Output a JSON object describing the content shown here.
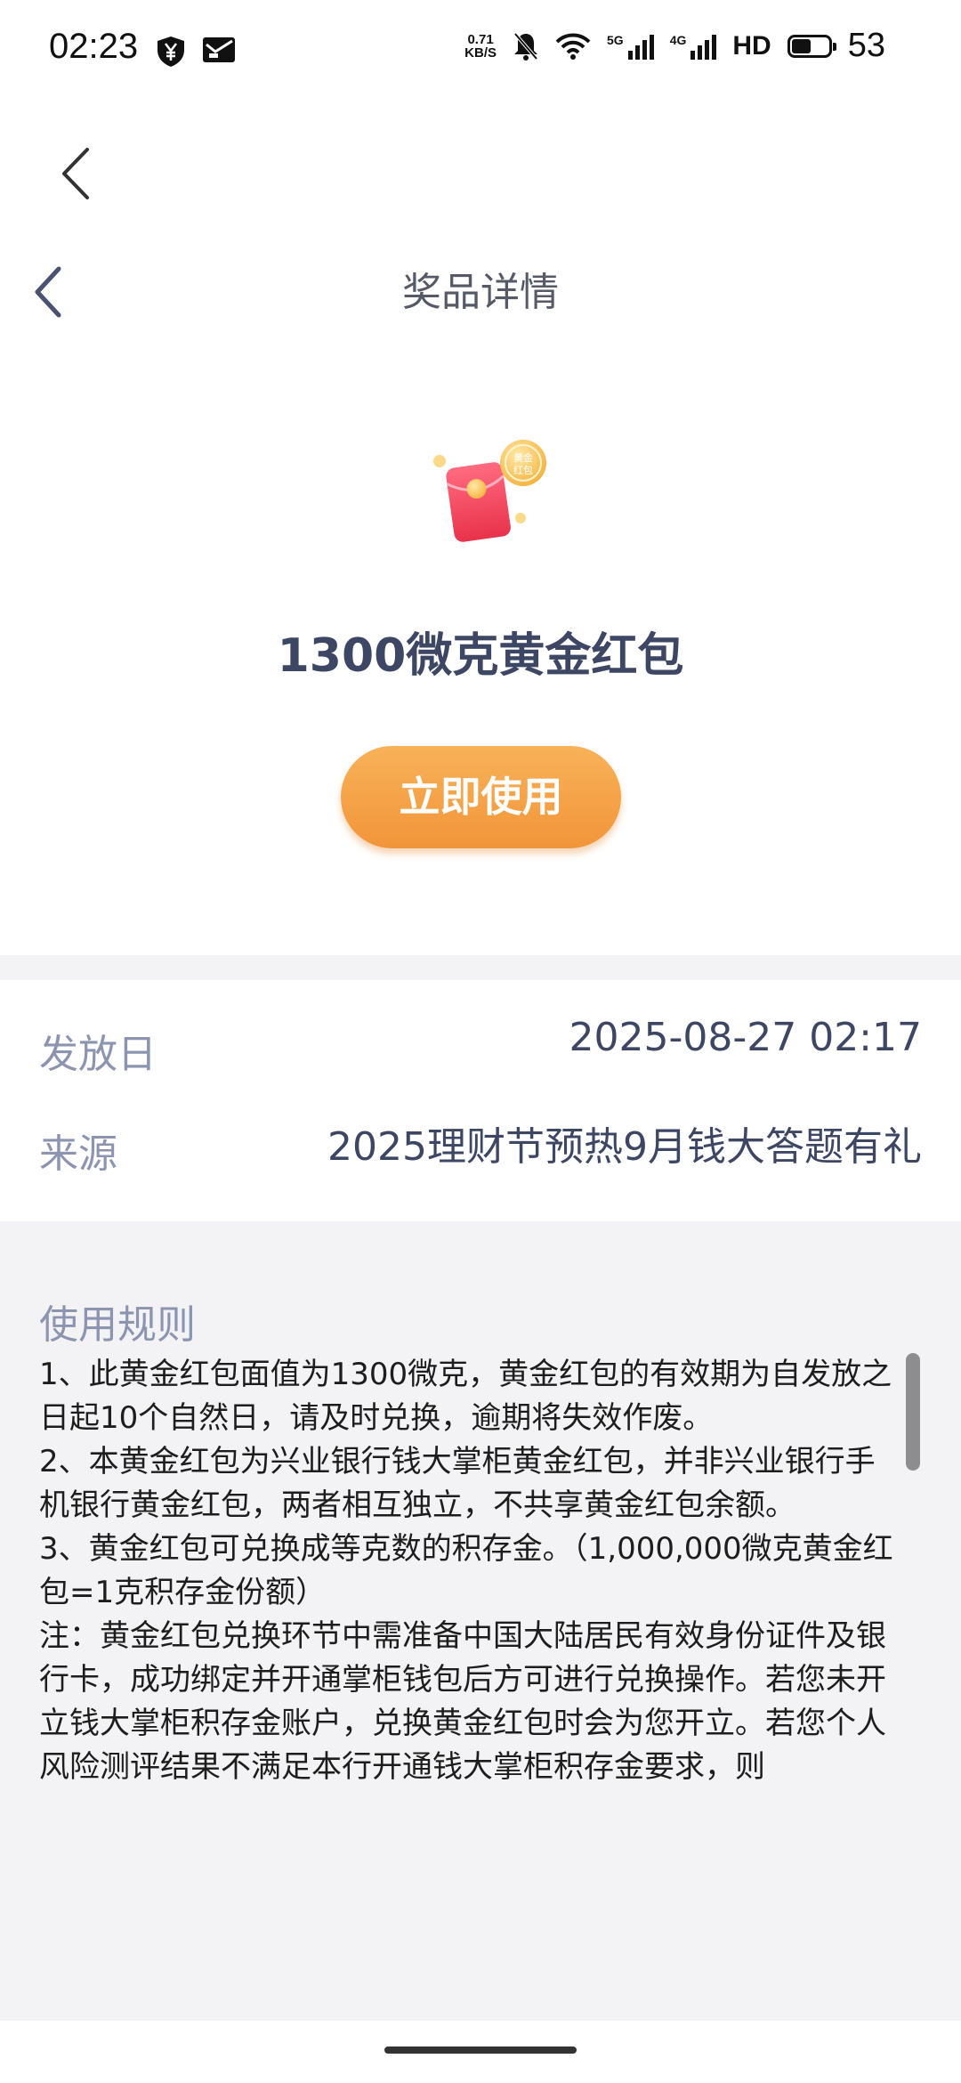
{
  "status_bar": {
    "time": "02:23",
    "net_speed_value": "0.71",
    "net_speed_unit": "KB/S",
    "sim1_label": "5G",
    "sim2_label": "4G",
    "hd_label": "HD",
    "battery_level": 53,
    "battery_text": "53"
  },
  "header": {
    "title": "奖品详情"
  },
  "prize": {
    "name": "1300微克黄金红包",
    "icon_badge_text": "黄金红包",
    "use_button_label": "立即使用"
  },
  "info": {
    "issue_label": "发放日",
    "issue_value": "2025-08-27 02:17",
    "source_label": "来源",
    "source_value": "2025理财节预热9月钱大答题有礼"
  },
  "rules": {
    "title": "使用规则",
    "paragraphs": [
      "1、此黄金红包面值为1300微克，黄金红包的有效期为自发放之日起10个自然日，请及时兑换，逾期将失效作废。",
      "2、本黄金红包为兴业银行钱大掌柜黄金红包，并非兴业银行手机银行黄金红包，两者相互独立，不共享黄金红包余额。",
      "3、黄金红包可兑换成等克数的积存金。（1,000,000微克黄金红包=1克积存金份额）",
      "注：黄金红包兑换环节中需准备中国大陆居民有效身份证件及银行卡，成功绑定并开通掌柜钱包后方可进行兑换操作。若您未开立钱大掌柜积存金账户，兑换黄金红包时会为您开立。若您个人风险测评结果不满足本行开通钱大掌柜积存金要求，则"
    ]
  },
  "colors": {
    "button_orange": "#f2953a",
    "label_gray_blue": "#8c94b0",
    "value_dark_blue": "#3d4663",
    "band_gray": "#f3f3f5"
  }
}
